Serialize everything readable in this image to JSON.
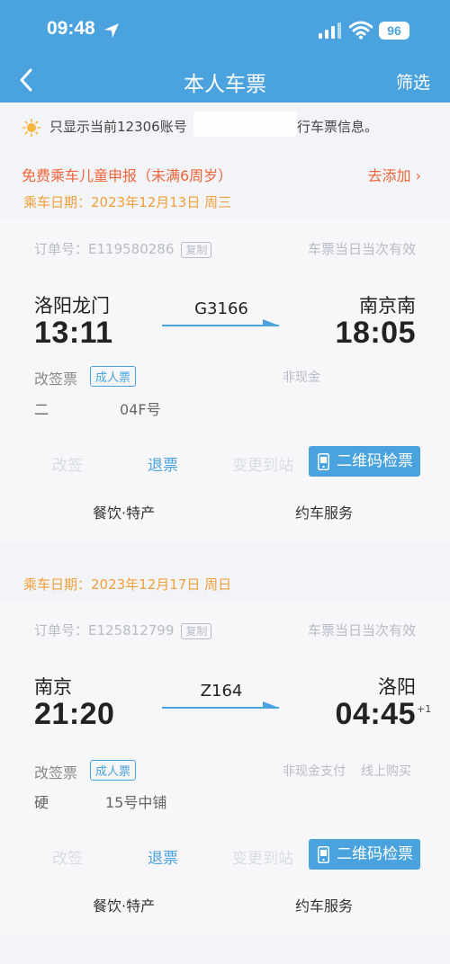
{
  "status": {
    "time": "09:48",
    "battery": "96"
  },
  "nav": {
    "title": "本人车票",
    "filter": "筛选"
  },
  "notice": {
    "text": "只显示当前12306账号",
    "text_tail": "行车票信息。"
  },
  "child": {
    "report": "免费乘车儿童申报（未满6周岁）",
    "add": "去添加 ›"
  },
  "tickets": [
    {
      "date": "乘车日期：2023年12月13日 周三",
      "order_label": "订单号：E119580286",
      "copy": "复制",
      "validity": "车票当日当次有效",
      "from": "洛阳龙门",
      "to": "南京南",
      "train": "G3166",
      "depart": "13:11",
      "arrive": "18:05",
      "plus": "",
      "change": "改签票",
      "type": "成人票",
      "pay": "非现金",
      "pay2": "",
      "seat_a": "二",
      "seat_b": "04F号",
      "refund": "退票",
      "qr": "二维码检票",
      "food": "餐饮·特产",
      "car": "约车服务"
    },
    {
      "date": "乘车日期：2023年12月17日 周日",
      "order_label": "订单号：E125812799",
      "copy": "复制",
      "validity": "车票当日当次有效",
      "from": "南京",
      "to": "洛阳",
      "train": "Z164",
      "depart": "21:20",
      "arrive": "04:45",
      "plus": "+1",
      "change": "改签票",
      "type": "成人票",
      "pay": "非现金支付",
      "pay2": "线上购买",
      "seat_a": "硬",
      "seat_b": "15号中铺",
      "refund": "退票",
      "qr": "二维码检票",
      "food": "餐饮·特产",
      "car": "约车服务"
    }
  ],
  "colors": {
    "header": "#4aa3df",
    "accent": "#4aa3df",
    "orange": "#f0643a",
    "date": "#f0a03a"
  }
}
